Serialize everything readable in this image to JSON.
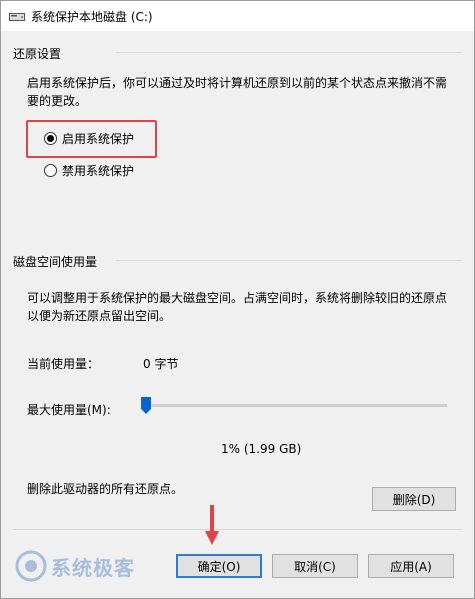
{
  "window": {
    "title": "系统保护本地磁盘 (C:)"
  },
  "restore": {
    "section_title": "还原设置",
    "description_line1": "启用系统保护后，你可以通过及时将计算机还原到以前的某个状态点来撤消不需",
    "description_line2": "要的更改。",
    "options": [
      {
        "label": "启用系统保护",
        "checked": true
      },
      {
        "label": "禁用系统保护",
        "checked": false
      }
    ]
  },
  "disk": {
    "section_title": "磁盘空间使用量",
    "description_line1": "可以调整用于系统保护的最大磁盘空间。占满空间时，系统将删除较旧的还原点",
    "description_line2": "以便为新还原点留出空间。",
    "current_usage_label": "当前使用量：",
    "current_usage_value": "0 字节",
    "max_usage_label": "最大使用量(M):",
    "max_usage_percent": 1,
    "max_usage_text": "1% (1.99 GB)",
    "delete_text": "删除此驱动器的所有还原点。",
    "delete_button": "删除(D)"
  },
  "buttons": {
    "ok": "确定(O)",
    "cancel": "取消(C)",
    "apply": "应用(A)"
  },
  "watermark": {
    "text": "系统极客"
  },
  "colors": {
    "accent": "#0a63d1",
    "highlight": "#e0424a",
    "watermark": "#a8bedc"
  }
}
